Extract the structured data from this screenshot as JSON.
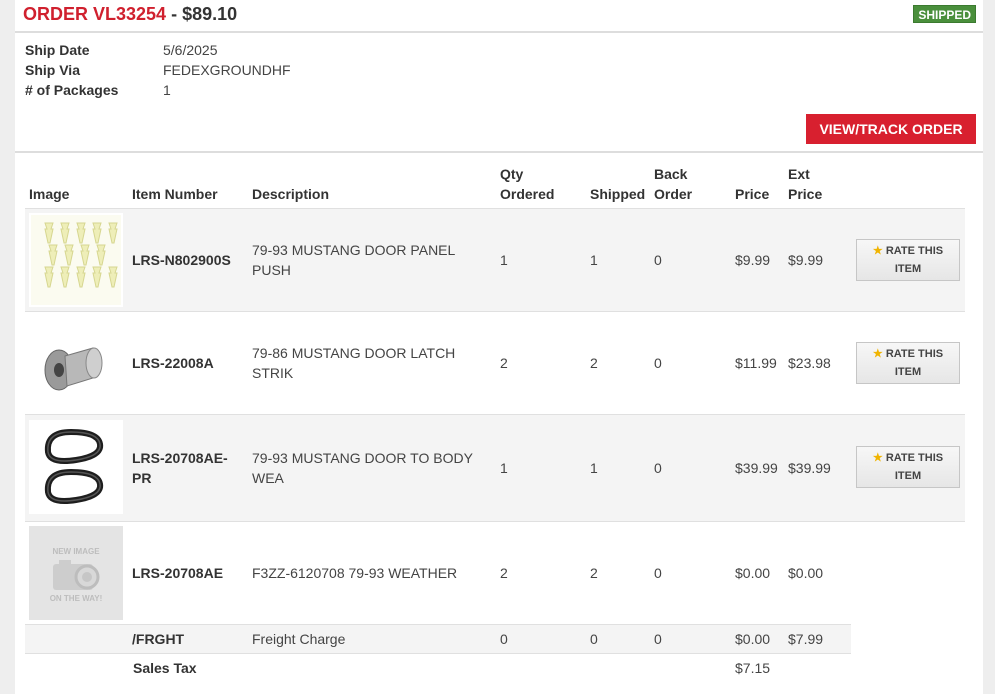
{
  "order": {
    "title_prefix": "ORDER VL33254",
    "separator": " - ",
    "amount": "$89.10",
    "status": "SHIPPED"
  },
  "meta": [
    {
      "label": "Ship Date",
      "value": "5/6/2025"
    },
    {
      "label": "Ship Via",
      "value": "FEDEXGROUNDHF"
    },
    {
      "label": "# of Packages",
      "value": "1"
    }
  ],
  "track_button": "VIEW/TRACK ORDER",
  "columns": {
    "image": "Image",
    "item_number": "Item Number",
    "description": "Description",
    "qty_ordered_1": "Qty",
    "qty_ordered_2": "Ordered",
    "shipped": "Shipped",
    "back_order_1": "Back",
    "back_order_2": "Order",
    "price": "Price",
    "ext_price_1": "Ext",
    "ext_price_2": "Price"
  },
  "rate_button": {
    "line1": "RATE THIS",
    "line2": "ITEM"
  },
  "items": [
    {
      "item_number": "LRS-N802900S",
      "item_number_2": "",
      "description_1": "79-93 MUSTANG DOOR PANEL",
      "description_2": "PUSH",
      "qty": "1",
      "shipped": "1",
      "back_order": "0",
      "price": "$9.99",
      "ext_price": "$9.99"
    },
    {
      "item_number": "LRS-22008A",
      "item_number_2": "",
      "description_1": "79-86 MUSTANG DOOR LATCH",
      "description_2": "STRIK",
      "qty": "2",
      "shipped": "2",
      "back_order": "0",
      "price": "$11.99",
      "ext_price": "$23.98"
    },
    {
      "item_number": "LRS-20708AE-",
      "item_number_2": "PR",
      "description_1": "79-93 MUSTANG DOOR TO BODY",
      "description_2": "WEA",
      "qty": "1",
      "shipped": "1",
      "back_order": "0",
      "price": "$39.99",
      "ext_price": "$39.99"
    },
    {
      "item_number": "LRS-20708AE",
      "item_number_2": "",
      "description_1": "F3ZZ-6120708 79-93 WEATHER",
      "description_2": "",
      "qty": "2",
      "shipped": "2",
      "back_order": "0",
      "price": "$0.00",
      "ext_price": "$0.00"
    }
  ],
  "placeholder_image": {
    "line1": "NEW IMAGE",
    "line2": "ON THE WAY!"
  },
  "freight": {
    "item_number": "/FRGHT",
    "description": "Freight Charge",
    "qty": "0",
    "shipped": "0",
    "back_order": "0",
    "price": "$0.00",
    "ext_price": "$7.99"
  },
  "sales_tax": {
    "label": "Sales Tax",
    "amount": "$7.15"
  }
}
